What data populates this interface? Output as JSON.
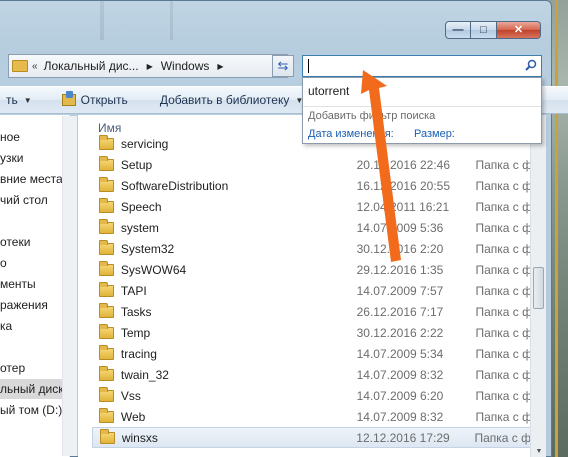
{
  "window": {
    "accent": "#1a5fb4",
    "selection_bg": "#d9d9d9"
  },
  "window_buttons": [
    {
      "icon": "minimize-icon",
      "glyph": "—"
    },
    {
      "icon": "maximize-icon",
      "glyph": "□"
    },
    {
      "icon": "close-icon",
      "glyph": "✕"
    }
  ],
  "address": {
    "overflow": "«",
    "crumbs": [
      "Локальный дис...",
      "Windows"
    ]
  },
  "search": {
    "value": "",
    "placeholder": ""
  },
  "toolbar": {
    "first_label": "ть",
    "open_label": "Открыть",
    "library_label": "Добавить в библиотеку"
  },
  "nav_items": [
    {
      "label": "ное",
      "selected": false
    },
    {
      "label": "узки",
      "selected": false
    },
    {
      "label": "вние места",
      "selected": false
    },
    {
      "label": "чий стол",
      "selected": false
    },
    {
      "label": "отеки",
      "selected": false
    },
    {
      "label": "о",
      "selected": false
    },
    {
      "label": "менты",
      "selected": false
    },
    {
      "label": "ражения",
      "selected": false
    },
    {
      "label": "ка",
      "selected": false
    },
    {
      "label": "отер",
      "selected": false
    },
    {
      "label": "льный диск",
      "selected": true
    },
    {
      "label": "ый том (D:)",
      "selected": false
    }
  ],
  "files": {
    "column_name": "Имя",
    "rows": [
      {
        "name": "servicing",
        "date": "",
        "type": ""
      },
      {
        "name": "Setup",
        "date": "20.10.2016 22:46",
        "type": "Папка с ф"
      },
      {
        "name": "SoftwareDistribution",
        "date": "16.12.2016 20:55",
        "type": "Папка с ф"
      },
      {
        "name": "Speech",
        "date": "12.04.2011 16:21",
        "type": "Папка с ф"
      },
      {
        "name": "system",
        "date": "14.07.2009 5:36",
        "type": "Папка с ф"
      },
      {
        "name": "System32",
        "date": "30.12.2016 2:20",
        "type": "Папка с ф"
      },
      {
        "name": "SysWOW64",
        "date": "29.12.2016 1:35",
        "type": "Папка с ф"
      },
      {
        "name": "TAPI",
        "date": "14.07.2009 7:57",
        "type": "Папка с ф"
      },
      {
        "name": "Tasks",
        "date": "26.12.2016 7:17",
        "type": "Папка с ф"
      },
      {
        "name": "Temp",
        "date": "30.12.2016 2:22",
        "type": "Папка с ф"
      },
      {
        "name": "tracing",
        "date": "14.07.2009 5:34",
        "type": "Папка с ф"
      },
      {
        "name": "twain_32",
        "date": "14.07.2009 8:32",
        "type": "Папка с ф"
      },
      {
        "name": "Vss",
        "date": "14.07.2009 6:20",
        "type": "Папка с ф"
      },
      {
        "name": "Web",
        "date": "14.07.2009 8:32",
        "type": "Папка с ф"
      },
      {
        "name": "winsxs",
        "date": "12.12.2016 17:29",
        "type": "Папка с ф"
      }
    ]
  },
  "search_popup": {
    "suggestion": "utorrent",
    "filter_title": "Добавить фильтр поиска",
    "filter_date": "Дата изменения:",
    "filter_size": "Размер:"
  },
  "annotation": {
    "color": "#f26b1d"
  }
}
